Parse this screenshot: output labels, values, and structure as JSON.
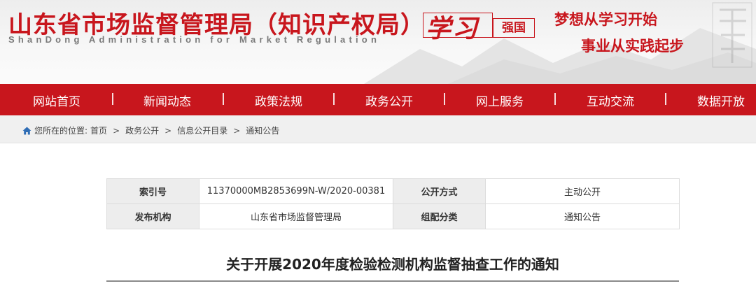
{
  "header": {
    "site_title": "山东省市场监督管理局（知识产权局）",
    "site_subtitle": "ShanDong Administration for Market Regulation",
    "xuexi_main": "学习",
    "xuexi_sub": "强国",
    "slogan_line1": "梦想从学习开始",
    "slogan_line2": "事业从实践起步",
    "brand_color": "#c8161d"
  },
  "nav": {
    "items": [
      {
        "label": "网站首页"
      },
      {
        "label": "新闻动态"
      },
      {
        "label": "政策法规"
      },
      {
        "label": "政务公开"
      },
      {
        "label": "网上服务"
      },
      {
        "label": "互动交流"
      },
      {
        "label": "数据开放"
      }
    ]
  },
  "breadcrumb": {
    "prefix": "您所在的位置:",
    "items": [
      "首页",
      "政务公开",
      "信息公开目录",
      "通知公告"
    ],
    "separator": ">"
  },
  "info": {
    "index_label": "索引号",
    "index_value": "11370000MB2853699N-W/2020-00381",
    "publicity_label": "公开方式",
    "publicity_value": "主动公开",
    "issuer_label": "发布机构",
    "issuer_value": "山东省市场监督管理局",
    "category_label": "组配分类",
    "category_value": "通知公告"
  },
  "article": {
    "title": "关于开展2020年度检验检测机构监督抽查工作的通知"
  }
}
